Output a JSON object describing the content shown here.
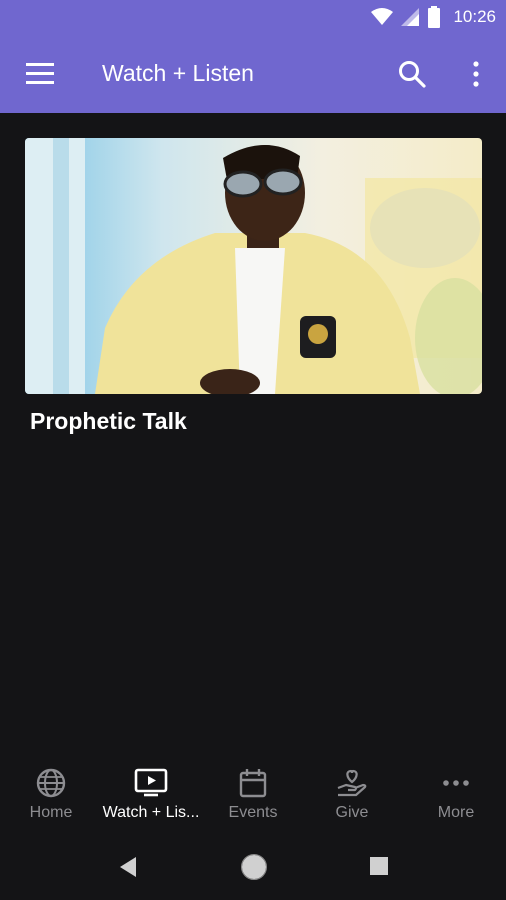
{
  "status_bar": {
    "time": "10:26",
    "icons": [
      "wifi-icon",
      "signal-icon",
      "battery-icon"
    ]
  },
  "app_bar": {
    "title": "Watch + Listen",
    "icons": [
      "menu-icon",
      "search-icon",
      "more-vert-icon"
    ],
    "color": "#7067cf"
  },
  "content": {
    "items": [
      {
        "title": "Prophetic Talk"
      }
    ]
  },
  "bottom_nav": {
    "items": [
      {
        "label": "Home",
        "icon": "globe-icon",
        "active": false
      },
      {
        "label": "Watch + Lis...",
        "icon": "tv-play-icon",
        "active": true
      },
      {
        "label": "Events",
        "icon": "calendar-icon",
        "active": false
      },
      {
        "label": "Give",
        "icon": "give-hand-heart-icon",
        "active": false
      },
      {
        "label": "More",
        "icon": "more-horiz-icon",
        "active": false
      }
    ]
  },
  "system_nav": [
    "back-icon",
    "home-circle-icon",
    "recents-icon"
  ],
  "colors": {
    "background": "#141416",
    "accent": "#7067cf",
    "nav_inactive": "#8d8d91",
    "nav_active": "#ffffff"
  }
}
